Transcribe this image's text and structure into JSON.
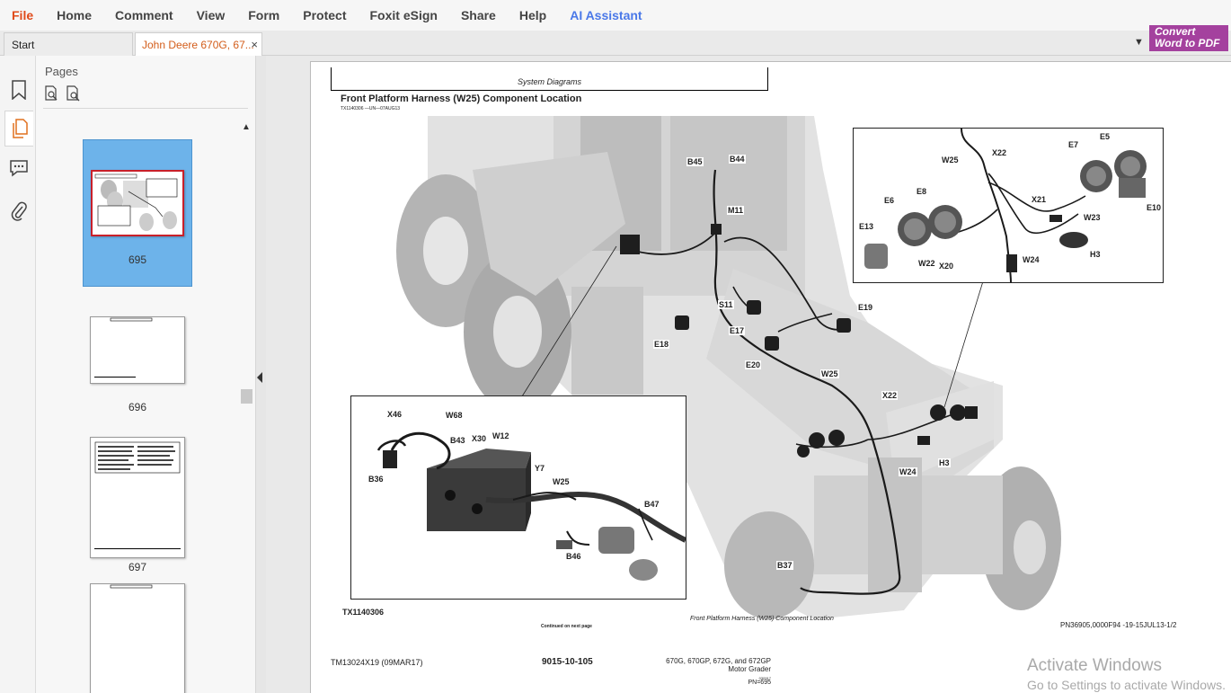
{
  "menu": {
    "items": [
      "File",
      "Home",
      "Comment",
      "View",
      "Form",
      "Protect",
      "Foxit eSign",
      "Share",
      "Help",
      "AI Assistant"
    ]
  },
  "tabs": {
    "start": "Start",
    "document": "John Deere 670G, 67...",
    "close_symbol": "×"
  },
  "convert": {
    "line1": "Convert",
    "line2": "Word to PDF"
  },
  "pages_panel": {
    "title": "Pages",
    "thumbnails": [
      {
        "number": "695",
        "selected": true
      },
      {
        "number": "696",
        "selected": false
      },
      {
        "number": "697",
        "selected": false
      }
    ]
  },
  "document": {
    "section_header": "System Diagrams",
    "title": "Front Platform Harness (W25) Component Location",
    "ref_code": "TX1140306 —UN—07AUG13",
    "figure_id": "TX1140306",
    "continued": "Continued on next page",
    "caption": "Front Platform Harness (W25) Component Location",
    "pn_ref": "PN36905,0000F94 -19-15JUL13-1/2",
    "footer_left": "TM13024X19 (09MAR17)",
    "footer_mid": "9015-10-105",
    "footer_right_line1": "670G, 670GP, 672G, and 672GP",
    "footer_right_line2": "Motor Grader",
    "footer_small": "030917",
    "footer_pn": "PN=695",
    "labels_main": {
      "b45": "B45",
      "b44": "B44",
      "m11": "M11",
      "s11": "S11",
      "e17": "E17",
      "e18": "E18",
      "e19": "E19",
      "e20": "E20",
      "w25": "W25",
      "x22": "X22",
      "w24": "W24",
      "h3": "H3",
      "b37": "B37"
    },
    "labels_inset_top": {
      "w25": "W25",
      "x22": "X22",
      "e7": "E7",
      "e5": "E5",
      "e10": "E10",
      "x21": "X21",
      "w23": "W23",
      "e6": "E6",
      "e8": "E8",
      "e13": "E13",
      "h3": "H3",
      "w24": "W24",
      "w22": "W22",
      "x20": "X20"
    },
    "labels_inset_bottom": {
      "x46": "X46",
      "w68": "W68",
      "b43": "B43",
      "x30": "X30",
      "w12": "W12",
      "y7": "Y7",
      "w25": "W25",
      "b36": "B36",
      "b47": "B47",
      "b46": "B46"
    }
  },
  "watermark": {
    "line1": "Activate Windows",
    "line2": "Go to Settings to activate Windows."
  },
  "colors": {
    "file_menu": "#e04a1a",
    "ai_assistant": "#4a78e8",
    "doc_tab_text": "#d35d1a",
    "convert_bg": "#a4419e",
    "thumb_selected_bg": "#6db3ea"
  },
  "icons": [
    "bookmark-icon",
    "pages-icon",
    "comment-icon",
    "attachment-icon",
    "page-zoom-icon",
    "page-search-icon",
    "chevron-up-icon",
    "collapse-left-icon",
    "dropdown-icon"
  ]
}
